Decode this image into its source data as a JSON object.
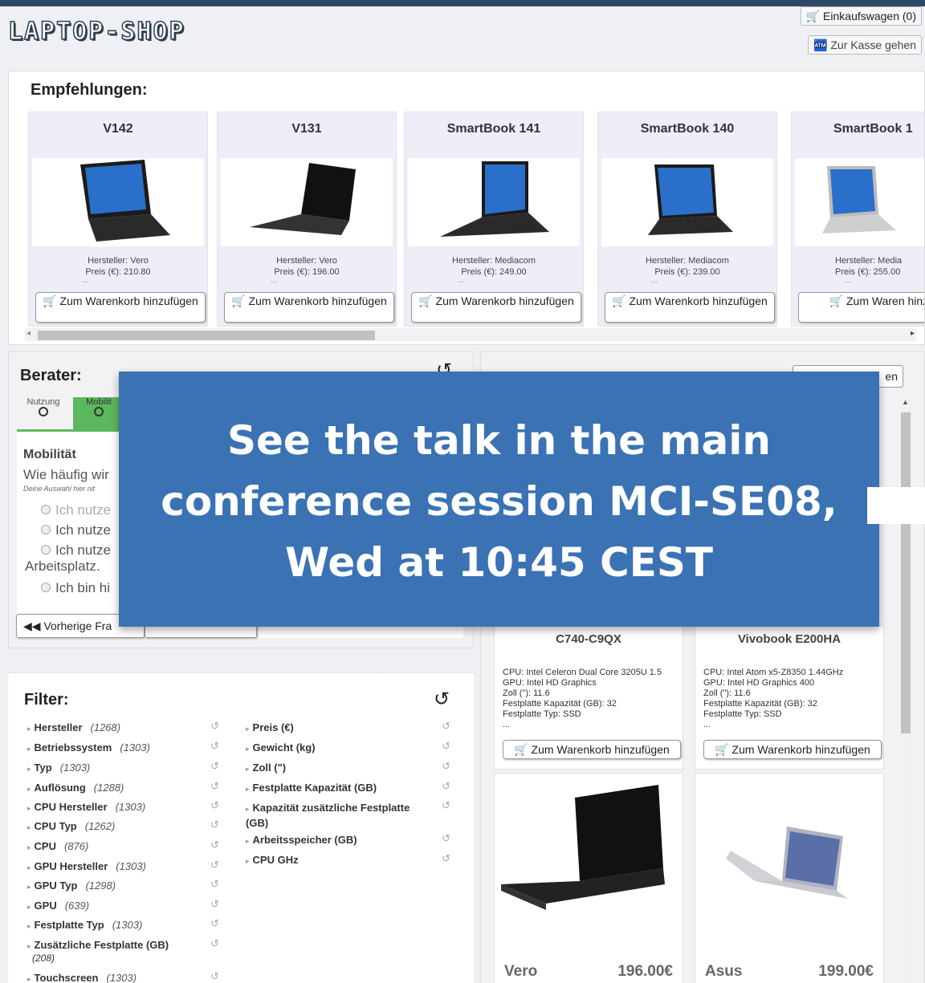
{
  "header": {
    "logo": "LAPTOP-SHOP",
    "cart_label": "Einkaufswagen (0)",
    "checkout_label": "Zur Kasse gehen"
  },
  "recommendations": {
    "title": "Empfehlungen:",
    "items": [
      {
        "name": "V142",
        "manufacturer": "Hersteller: Vero",
        "price": "Preis (€): 210.80",
        "dots": "...",
        "add_label": "Zum Warenkorb hinzufügen"
      },
      {
        "name": "V131",
        "manufacturer": "Hersteller: Vero",
        "price": "Preis (€): 196.00",
        "dots": "...",
        "add_label": "Zum Warenkorb hinzufügen"
      },
      {
        "name": "SmartBook 141",
        "manufacturer": "Hersteller: Mediacom",
        "price": "Preis (€): 249.00",
        "dots": "...",
        "add_label": "Zum Warenkorb hinzufügen"
      },
      {
        "name": "SmartBook 140",
        "manufacturer": "Hersteller: Mediacom",
        "price": "Preis (€): 239.00",
        "dots": "...",
        "add_label": "Zum Warenkorb hinzufügen"
      },
      {
        "name": "SmartBook 1",
        "manufacturer": "Hersteller: Media",
        "price": "Preis (€): 255.00",
        "dots": "...",
        "add_label": "Zum Waren hinzufügen"
      }
    ]
  },
  "advisor": {
    "title": "Berater:",
    "tabs": [
      {
        "label": "Nutzung"
      },
      {
        "label": "Mobilit"
      }
    ],
    "question_title": "Mobilität",
    "question_text": "Wie häufig wir",
    "question_hint": "Deine Auswahl hier nit",
    "options": [
      "Ich nutze",
      "Ich nutze",
      "Ich nutze",
      "Arbeitsplatz.",
      "Ich bin hi"
    ],
    "prev_label": "Vorherige Fra"
  },
  "filter": {
    "title": "Filter:",
    "left": [
      {
        "label": "Hersteller",
        "count": "(1268)"
      },
      {
        "label": "Betriebssystem",
        "count": "(1303)"
      },
      {
        "label": "Typ",
        "count": "(1303)"
      },
      {
        "label": "Auflösung",
        "count": "(1288)"
      },
      {
        "label": "CPU Hersteller",
        "count": "(1303)"
      },
      {
        "label": "CPU Typ",
        "count": "(1262)"
      },
      {
        "label": "CPU",
        "count": "(876)"
      },
      {
        "label": "GPU Hersteller",
        "count": "(1303)"
      },
      {
        "label": "GPU Typ",
        "count": "(1298)"
      },
      {
        "label": "GPU",
        "count": "(639)"
      },
      {
        "label": "Festplatte Typ",
        "count": "(1303)"
      },
      {
        "label": "Zusätzliche Festplatte (GB)",
        "count": "(208)"
      },
      {
        "label": "Touchscreen",
        "count": "(1303)"
      }
    ],
    "right": [
      {
        "label": "Preis (€)"
      },
      {
        "label": "Gewicht (kg)"
      },
      {
        "label": "Zoll (\")"
      },
      {
        "label": "Festplatte Kapazität (GB)"
      },
      {
        "label": "Kapazität zusätzliche Festplatte (GB)"
      },
      {
        "label": "Arbeitsspeicher (GB)"
      },
      {
        "label": "CPU GHz"
      }
    ]
  },
  "products": {
    "sort_label": "en",
    "cards": [
      {
        "name": "C740-C9QX",
        "specs": [
          "CPU: Intel Celeron Dual Core 3205U 1.5",
          "GPU: Intel HD Graphics",
          "Zoll (\"): 11.6",
          "Festplatte Kapazität (GB): 32",
          "Festplatte Typ: SSD"
        ],
        "dots": "...",
        "add_label": "Zum Warenkorb hinzufügen"
      },
      {
        "name": "Vivobook E200HA",
        "specs": [
          "CPU: Intel Atom x5-Z8350 1.44GHz",
          "GPU: Intel HD Graphics 400",
          "Zoll (\"): 11.6",
          "Festplatte Kapazität (GB): 32",
          "Festplatte Typ: SSD"
        ],
        "dots": "...",
        "add_label": "Zum Warenkorb hinzufügen"
      }
    ],
    "bottom_cards": [
      {
        "brand": "Vero",
        "price": "196.00€"
      },
      {
        "brand": "Asus",
        "price": "199.00€"
      }
    ]
  },
  "overlay": {
    "line1": "See the talk in the main",
    "line2": "conference session MCI-SE08,",
    "line3": "Wed at 10:45 CEST"
  },
  "colors": {
    "overlay_bg": "#3a72b4",
    "topbar": "#2c4a68",
    "tab_active": "#5cb85c"
  }
}
